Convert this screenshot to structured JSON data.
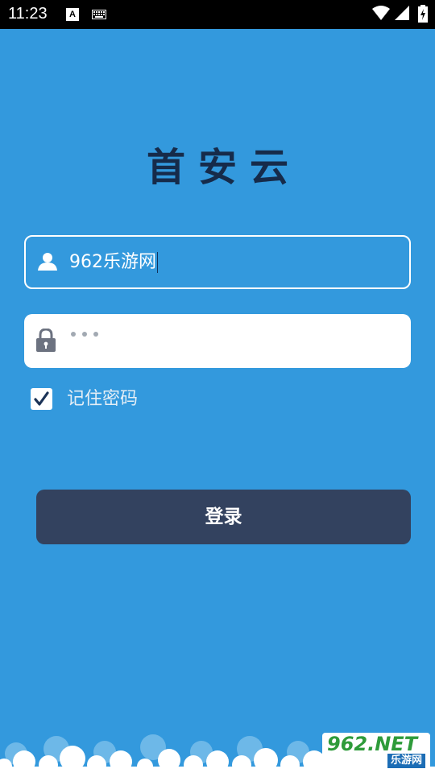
{
  "status_bar": {
    "time": "11:23",
    "notification_letter": "A"
  },
  "app": {
    "title": "首安云"
  },
  "login_form": {
    "username_value": "962乐游网",
    "password_mask": "•••",
    "remember_label": "记住密码",
    "remember_checked": true,
    "login_button": "登录"
  },
  "watermark": {
    "top_text": "962.NET",
    "bottom_text": "乐游网"
  },
  "colors": {
    "background": "#3399DD",
    "title": "#162B4A",
    "button": "#33425F",
    "checkmark": "#1B3357"
  }
}
